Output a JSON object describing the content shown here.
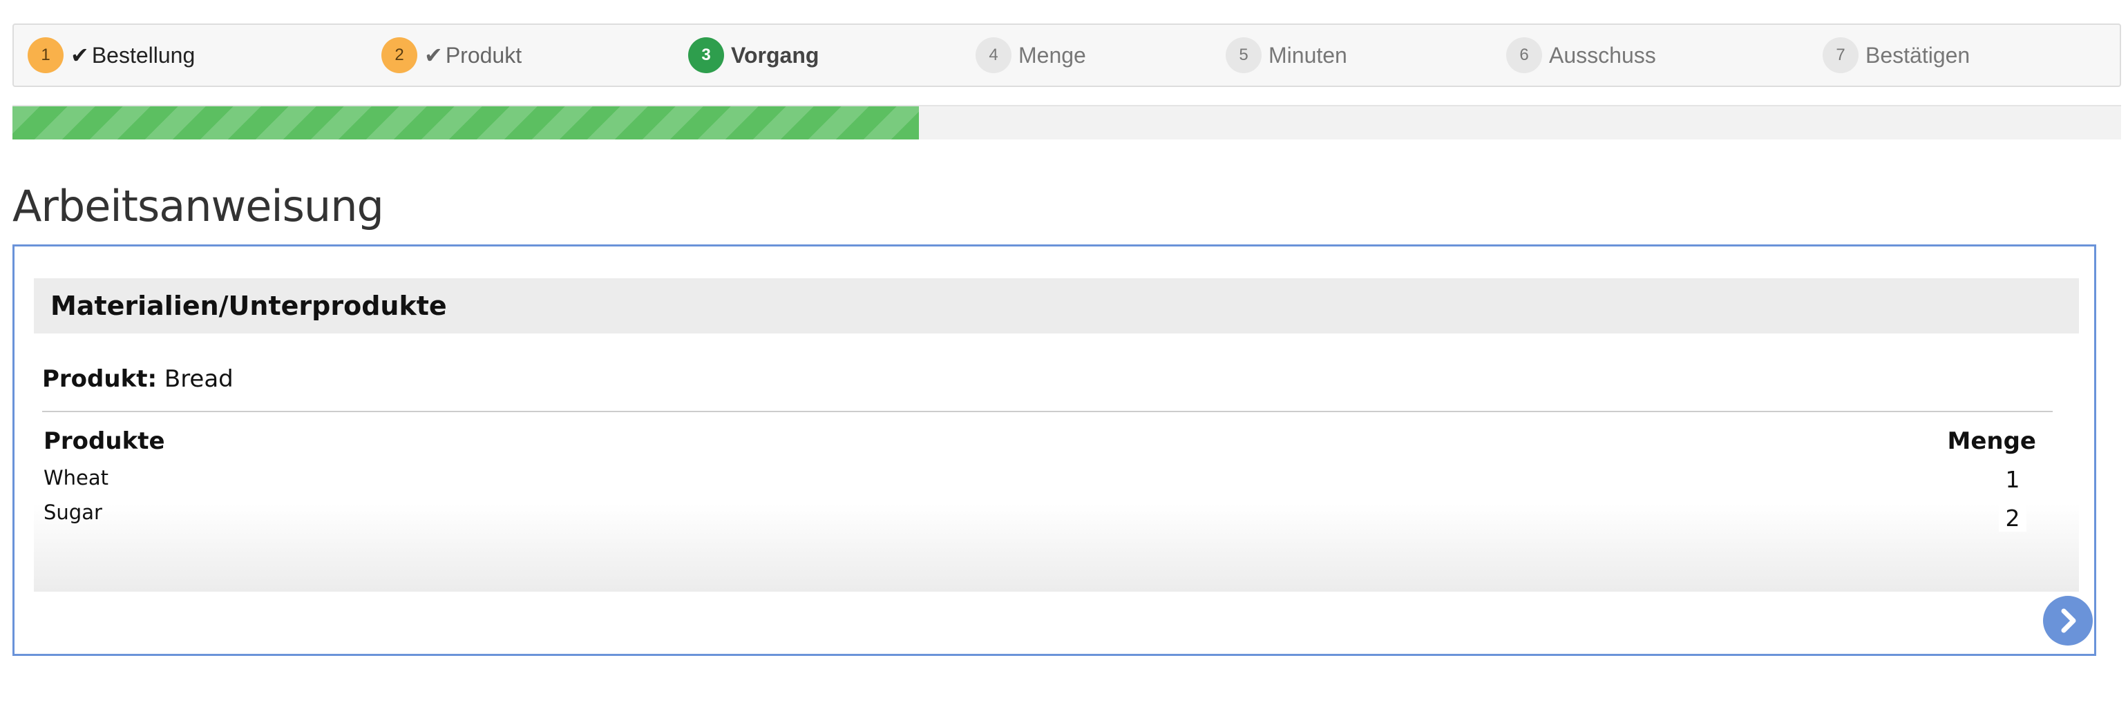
{
  "stepper": {
    "steps": [
      {
        "number": "1",
        "label": "Bestellung",
        "state": "done",
        "check": "✔"
      },
      {
        "number": "2",
        "label": "Produkt",
        "state": "done",
        "check": "✔"
      },
      {
        "number": "3",
        "label": "Vorgang",
        "state": "active"
      },
      {
        "number": "4",
        "label": "Menge",
        "state": "todo"
      },
      {
        "number": "5",
        "label": "Minuten",
        "state": "todo"
      },
      {
        "number": "6",
        "label": "Ausschuss",
        "state": "todo"
      },
      {
        "number": "7",
        "label": "Bestätigen",
        "state": "todo"
      }
    ],
    "colors": {
      "done": "#f9b14a",
      "active": "#2e9e4d",
      "todo": "#e7e7e7"
    }
  },
  "progress": {
    "fraction": 0.43,
    "color": "#5cbf61"
  },
  "page": {
    "title": "Arbeitsanweisung"
  },
  "panel": {
    "title": "Materialien/Unterprodukte",
    "product_key": "Produkt:",
    "product_value": "Bread",
    "columns": {
      "products": "Produkte",
      "quantity": "Menge"
    },
    "rows": [
      {
        "name": "Wheat",
        "qty": "1"
      },
      {
        "name": "Sugar",
        "qty": "2"
      }
    ]
  },
  "next_button": {
    "icon": "chevron-right-icon",
    "color": "#6a93d9"
  }
}
